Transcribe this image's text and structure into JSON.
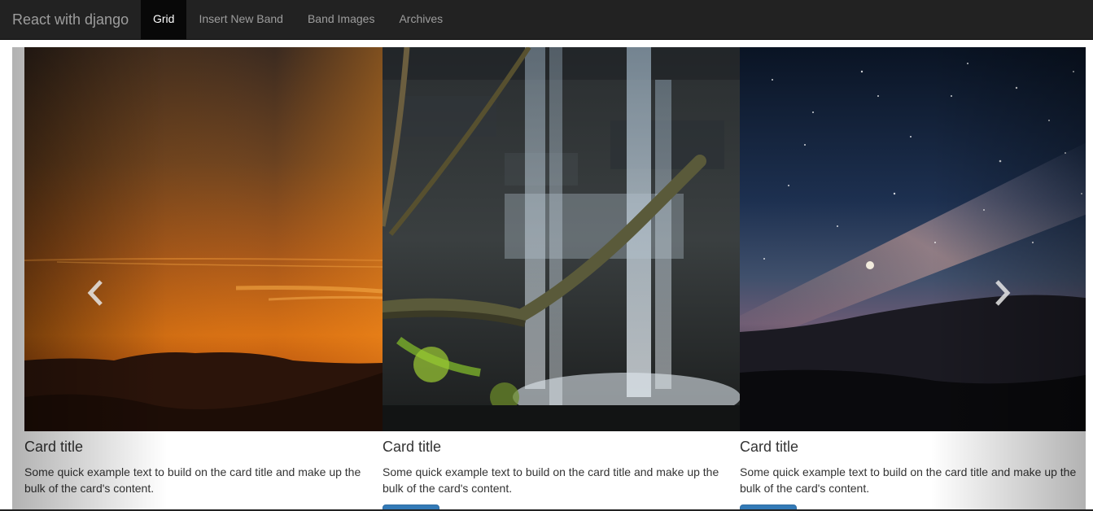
{
  "navbar": {
    "brand": "React with django",
    "items": [
      {
        "label": "Grid",
        "active": true
      },
      {
        "label": "Insert New Band",
        "active": false
      },
      {
        "label": "Band Images",
        "active": false
      },
      {
        "label": "Archives",
        "active": false
      }
    ]
  },
  "carousel": {
    "prev_icon": "chevron-left-icon",
    "next_icon": "chevron-right-icon",
    "cards": [
      {
        "image": "sunset-mountains-image",
        "title": "Card title",
        "text": "Some quick example text to build on the card title and make up the bulk of the card's content."
      },
      {
        "image": "waterfall-image",
        "title": "Card title",
        "text": "Some quick example text to build on the card title and make up the bulk of the card's content."
      },
      {
        "image": "milky-way-night-sky-image",
        "title": "Card title",
        "text": "Some quick example text to build on the card title and make up the bulk of the card's content."
      }
    ]
  },
  "colors": {
    "navbar_bg": "#222222",
    "active_nav_bg": "#080808",
    "button_primary": "#337ab7"
  }
}
